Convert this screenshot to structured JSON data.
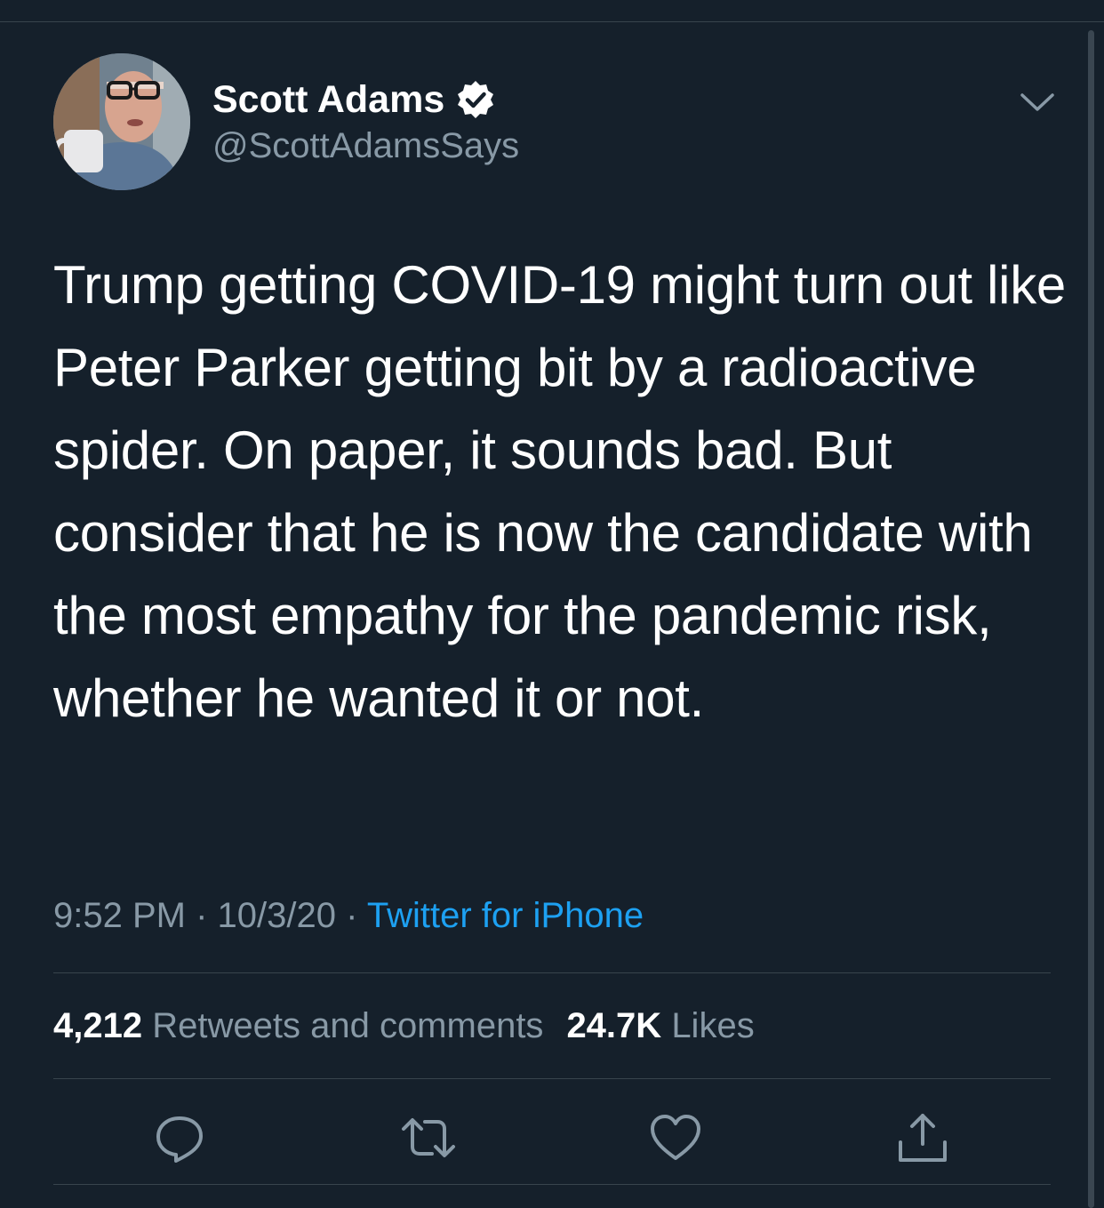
{
  "tweet": {
    "author": {
      "name": "Scott Adams",
      "handle": "@ScottAdamsSays",
      "verified": true
    },
    "text": "Trump getting COVID-19 might turn out like Peter Parker getting bit by a radioactive spider. On paper, it sounds bad. But consider that he is now the candidate with the most empathy for the pandemic risk, whether he wanted it or not.",
    "time": "9:52 PM",
    "separator": "·",
    "date": "10/3/20",
    "source": "Twitter for iPhone",
    "retweets_count": "4,212",
    "retweets_label": "Retweets and comments",
    "likes_count": "24.7K",
    "likes_label": "Likes"
  },
  "actions": {
    "reply": "reply-icon",
    "retweet": "retweet-icon",
    "like": "heart-icon",
    "share": "share-icon"
  },
  "colors": {
    "background": "#15202b",
    "text": "#ffffff",
    "secondary_text": "#8899a6",
    "link": "#1da1f2",
    "divider": "#38444d"
  }
}
